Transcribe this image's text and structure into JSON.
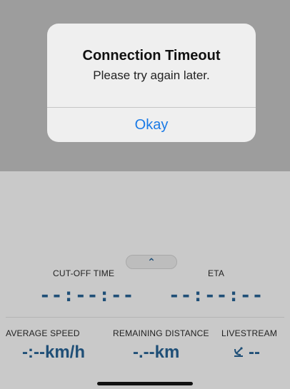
{
  "alert": {
    "title": "Connection Timeout",
    "message": "Please try again later.",
    "button_label": "Okay"
  },
  "toggle": {
    "icon": "chevron-up-icon",
    "glyph": "⌃"
  },
  "stats_top": {
    "cutoff_label": "CUT-OFF TIME",
    "cutoff_value": "--:--:--",
    "eta_label": "ETA",
    "eta_value": "--:--:--"
  },
  "stats_bottom": {
    "avg_speed_label": "AVERAGE SPEED",
    "avg_speed_value": "-:--km/h",
    "remaining_label": "REMAINING DISTANCE",
    "remaining_value": "-.--km",
    "livestream_label": "LIVESTREAM",
    "livestream_icon": "satellite-dish-icon",
    "livestream_value": "--"
  },
  "colors": {
    "accent_blue": "#1a7ae6",
    "stat_blue": "#1f4f77"
  }
}
